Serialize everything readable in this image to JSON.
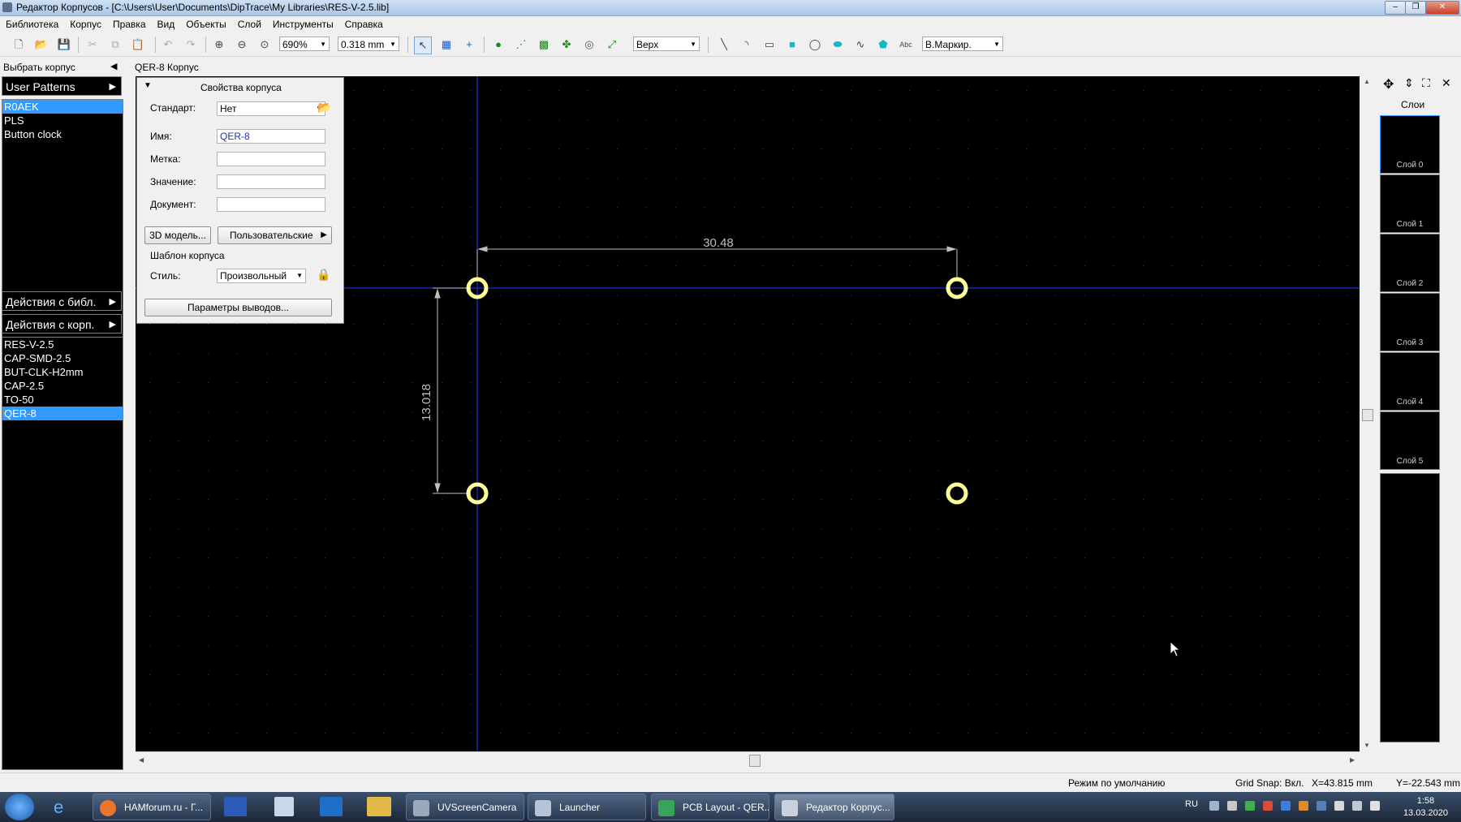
{
  "window": {
    "title": "Редактор Корпусов - [C:\\Users\\User\\Documents\\DipTrace\\My Libraries\\RES-V-2.5.lib]"
  },
  "menu": [
    "Библиотека",
    "Корпус",
    "Правка",
    "Вид",
    "Объекты",
    "Слой",
    "Инструменты",
    "Справка"
  ],
  "toolbar": {
    "zoom": "690%",
    "grid": "0.318 mm",
    "side": "Верх",
    "layer": "В.Маркир."
  },
  "left": {
    "select_label": "Выбрать корпус",
    "patterns_button": "User Patterns",
    "libraries": [
      "R0AEK",
      "PLS",
      "Button clock"
    ],
    "lib_actions": "Действия с библ.",
    "pat_actions": "Действия с корп.",
    "patterns": [
      "RES-V-2.5",
      "CAP-SMD-2.5",
      "BUT-CLK-H2mm",
      "CAP-2.5",
      "TO-50",
      "QER-8"
    ]
  },
  "canvas": {
    "header": "QER-8 Корпус",
    "dim_horizontal": "30.48",
    "dim_vertical": "13.018"
  },
  "props": {
    "title": "Свойства корпуса",
    "standard_label": "Стандарт:",
    "standard_value": "Нет",
    "name_label": "Имя:",
    "name_value": "QER-8",
    "mark_label": "Метка:",
    "value_label": "Значение:",
    "doc_label": "Документ:",
    "model_button": "3D модель...",
    "user_button": "Пользовательские",
    "template_label": "Шаблон корпуса",
    "style_label": "Стиль:",
    "style_value": "Произвольный",
    "pads_button": "Параметры выводов..."
  },
  "right": {
    "title": "Слои",
    "layers": [
      "Слой 0",
      "Слой 1",
      "Слой 2",
      "Слой 3",
      "Слой 4",
      "Слой 5"
    ]
  },
  "status": {
    "mode": "Режим по умолчанию",
    "snap": "Grid Snap: Вкл.",
    "x": "X=43.815 mm",
    "y": "Y=-22.543 mm"
  },
  "taskbar": {
    "items": [
      "HAMforum.ru - Г...",
      "UVScreenCamera",
      "Launcher",
      "PCB Layout - QER...",
      "Редактор Корпус..."
    ],
    "lang": "RU",
    "time": "1:58",
    "date": "13.03.2020"
  },
  "colors": {
    "canvas": "#000000",
    "pad": "#ffff99",
    "axis": "#0000cc",
    "selection": "#3399ff"
  }
}
